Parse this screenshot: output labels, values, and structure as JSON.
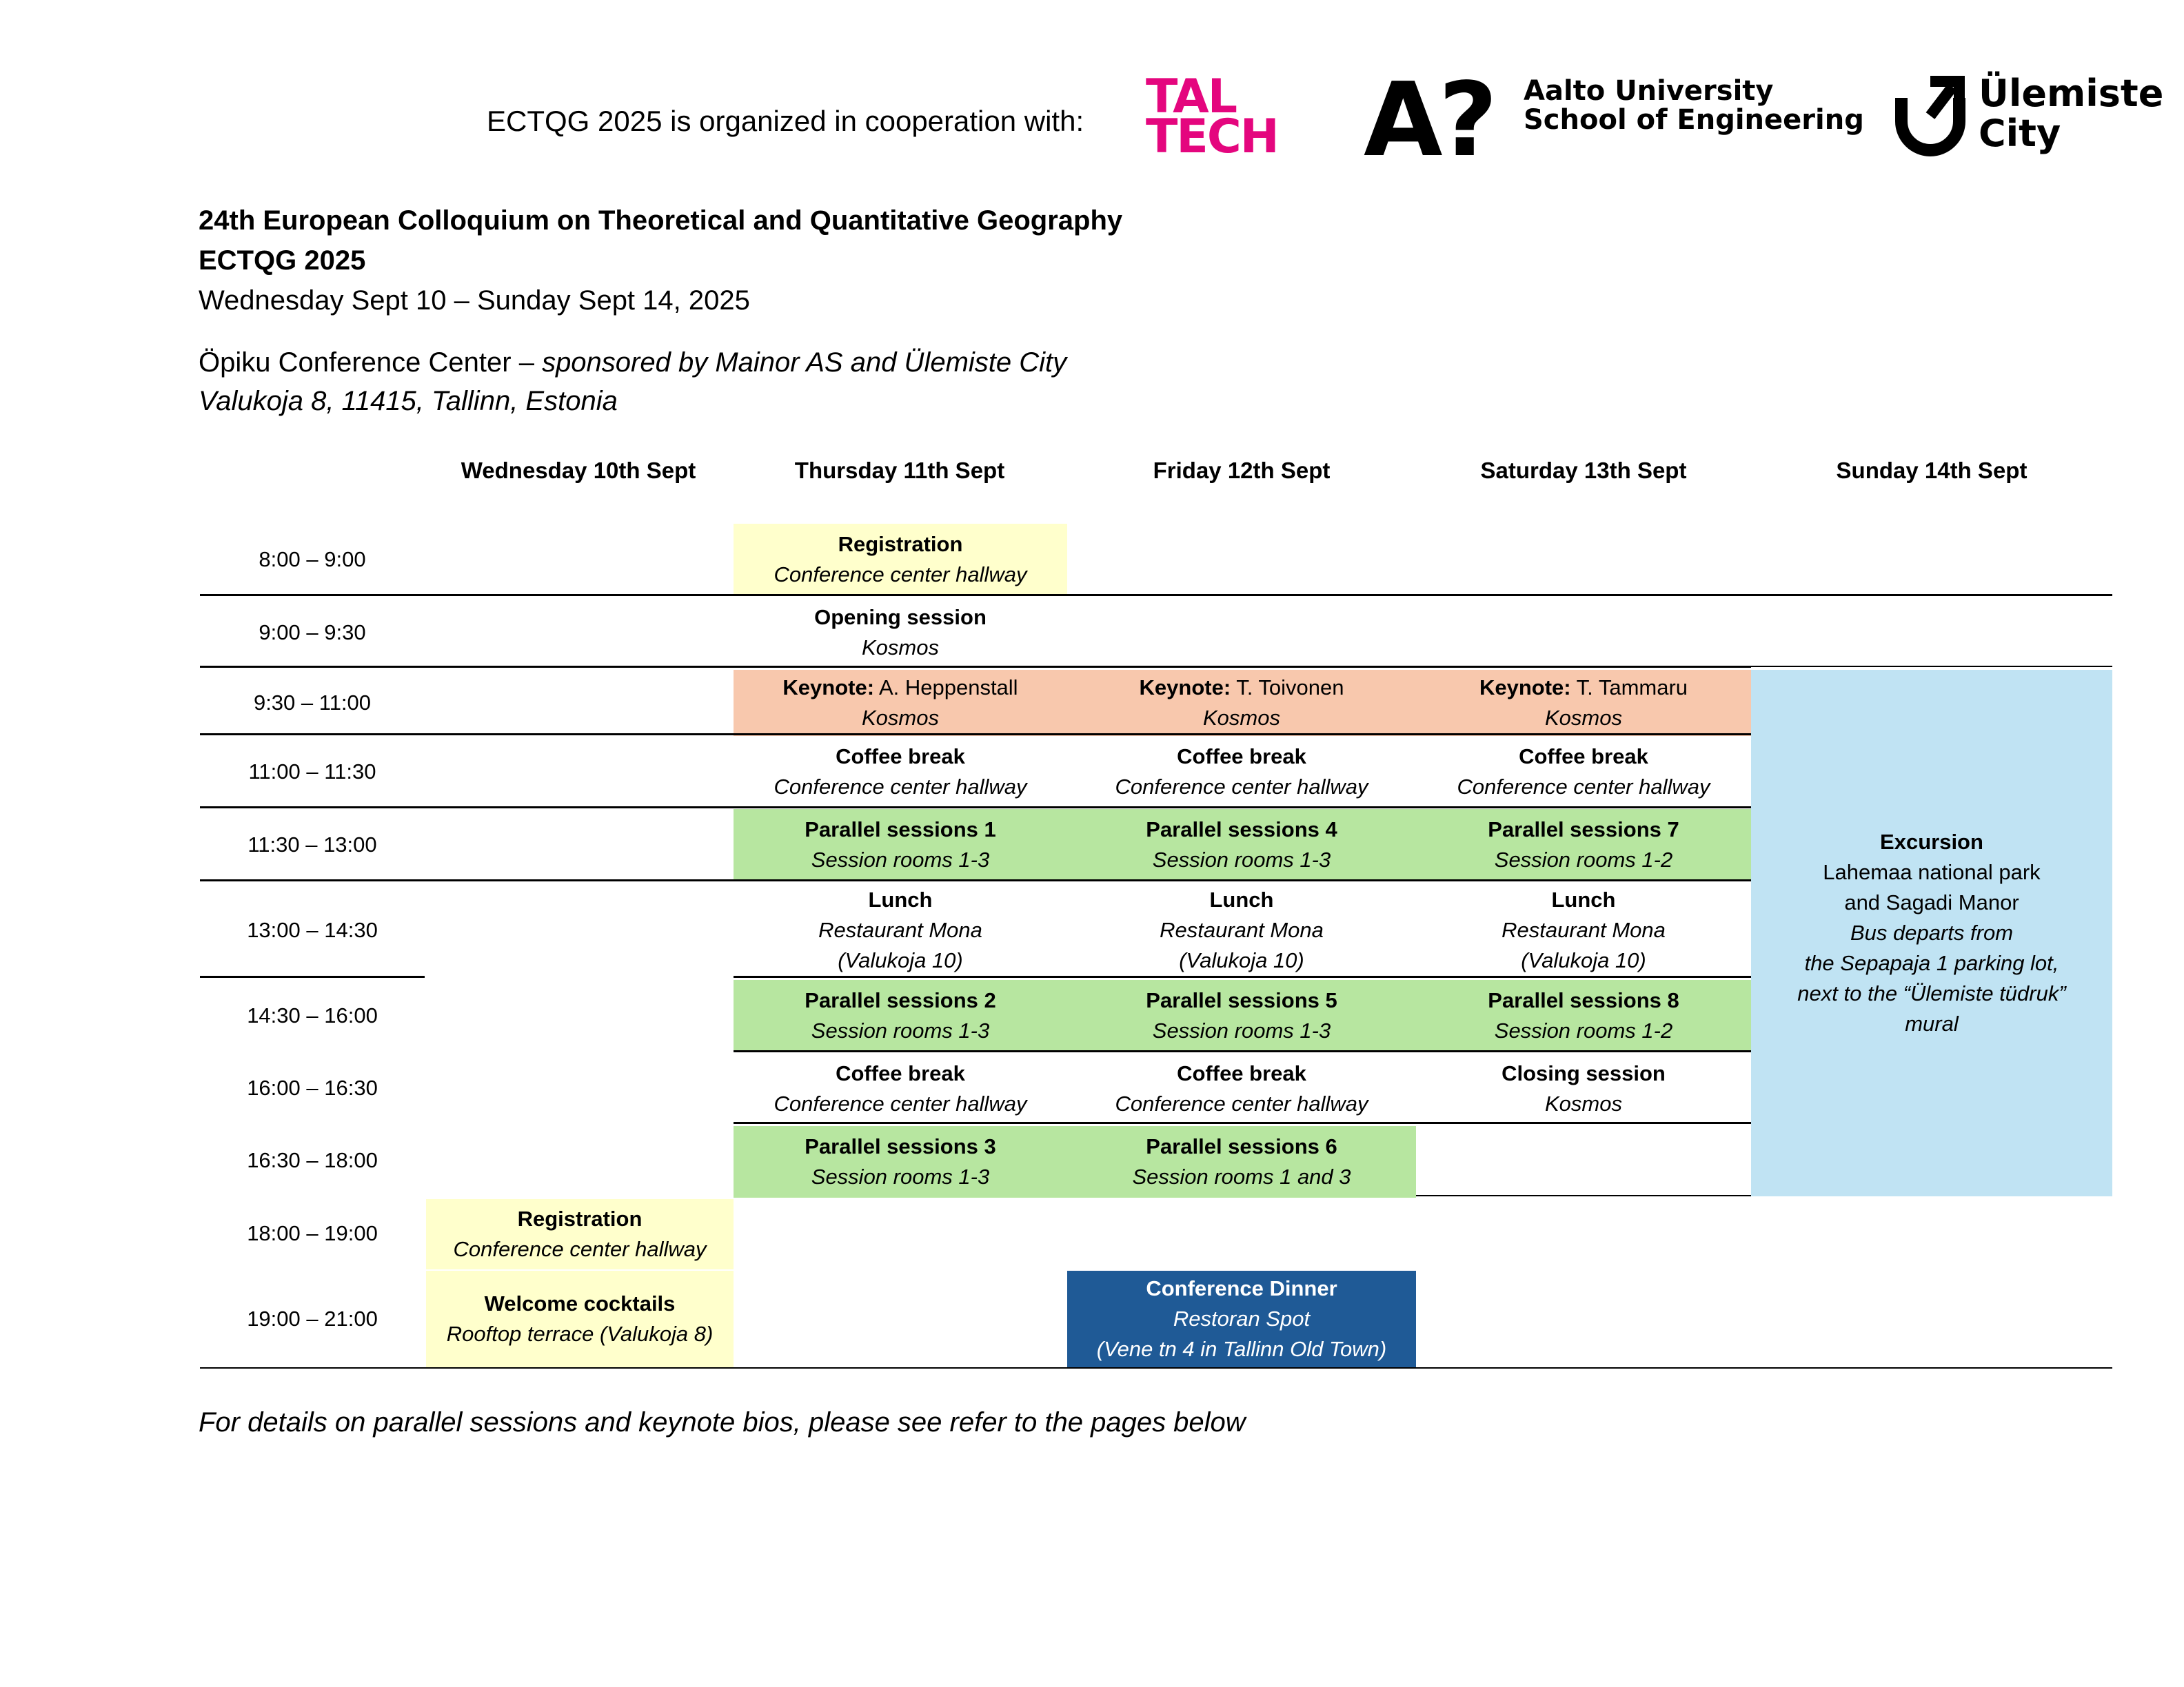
{
  "header": {
    "cooperation_text": "ECTQG 2025 is organized in cooperation with:",
    "logos": {
      "taltech": [
        "TAL",
        "TECH"
      ],
      "aalto_mark": "A?",
      "aalto_lines": [
        "Aalto University",
        "School of Engineering"
      ],
      "ulemiste_lines": [
        "Ülemiste",
        "City"
      ]
    },
    "colors": {
      "taltech": "#e4067e"
    }
  },
  "conference": {
    "title": "24th European Colloquium on Theoretical and Quantitative Geography",
    "short": "ECTQG 2025",
    "dates": "Wednesday Sept 10 – Sunday Sept 14, 2025",
    "venue_name": "Öpiku Conference Center",
    "venue_dash": " – ",
    "venue_sponsor": "sponsored by Mainor AS and Ülemiste City",
    "address": "Valukoja 8, 11415, Tallinn, Estonia"
  },
  "schedule": {
    "days": [
      "Wednesday 10th Sept",
      "Thursday 11th Sept",
      "Friday 12th Sept",
      "Saturday 13th Sept",
      "Sunday 14th Sept"
    ],
    "times": [
      "8:00 – 9:00",
      "9:00 – 9:30",
      "9:30 – 11:00",
      "11:00 – 11:30",
      "11:30 – 13:00",
      "13:00 – 14:30",
      "14:30 – 16:00",
      "16:00 – 16:30",
      "16:30 – 18:00",
      "18:00 – 19:00",
      "19:00 – 21:00"
    ],
    "colors": {
      "registration": "#ffffcc",
      "keynote": "#f8c8ad",
      "parallel": "#b7e6a0",
      "excursion": "#c0e3f3",
      "dinner": "#1f5a96"
    },
    "thu": {
      "registration": {
        "title": "Registration",
        "place": "Conference center hallway"
      },
      "opening": {
        "title": "Opening session",
        "place": "Kosmos"
      },
      "keynote": {
        "label": "Keynote:",
        "name": " A. Heppenstall",
        "place": "Kosmos"
      },
      "coffee1": {
        "title": "Coffee break",
        "place": "Conference center hallway"
      },
      "parallel1": {
        "title": "Parallel sessions 1",
        "place": "Session rooms 1-3"
      },
      "lunch": {
        "title": "Lunch",
        "place": "Restaurant Mona",
        "place2": "(Valukoja 10)"
      },
      "parallel2": {
        "title": "Parallel sessions 2",
        "place": "Session rooms 1-3"
      },
      "coffee2": {
        "title": "Coffee break",
        "place": "Conference center hallway"
      },
      "parallel3": {
        "title": "Parallel sessions 3",
        "place": "Session rooms 1-3"
      }
    },
    "fri": {
      "keynote": {
        "label": "Keynote:",
        "name": " T. Toivonen",
        "place": "Kosmos"
      },
      "coffee1": {
        "title": "Coffee break",
        "place": "Conference center hallway"
      },
      "parallel4": {
        "title": "Parallel sessions 4",
        "place": "Session rooms 1-3"
      },
      "lunch": {
        "title": "Lunch",
        "place": "Restaurant Mona",
        "place2": "(Valukoja 10)"
      },
      "parallel5": {
        "title": "Parallel sessions 5",
        "place": "Session rooms 1-3"
      },
      "coffee2": {
        "title": "Coffee break",
        "place": "Conference center hallway"
      },
      "parallel6": {
        "title": "Parallel sessions 6",
        "place": "Session rooms 1 and 3"
      },
      "dinner": {
        "title": "Conference Dinner",
        "place": "Restoran Spot",
        "place2": "(Vene tn 4 in Tallinn Old Town)"
      }
    },
    "sat": {
      "keynote": {
        "label": "Keynote:",
        "name": " T. Tammaru",
        "place": "Kosmos"
      },
      "coffee1": {
        "title": "Coffee break",
        "place": "Conference center hallway"
      },
      "parallel7": {
        "title": "Parallel sessions 7",
        "place": "Session rooms 1-2"
      },
      "lunch": {
        "title": "Lunch",
        "place": "Restaurant Mona",
        "place2": "(Valukoja 10)"
      },
      "parallel8": {
        "title": "Parallel sessions 8",
        "place": "Session rooms 1-2"
      },
      "closing": {
        "title": "Closing session",
        "place": "Kosmos"
      }
    },
    "wed": {
      "registration": {
        "title": "Registration",
        "place": "Conference center hallway"
      },
      "cocktails": {
        "title": "Welcome cocktails",
        "place": "Rooftop terrace (Valukoja 8)"
      }
    },
    "sun": {
      "excursion": {
        "title": "Excursion",
        "line1": "Lahemaa national park",
        "line2": "and Sagadi Manor",
        "line3": "Bus departs from",
        "line4": "the Sepapaja 1 parking lot,",
        "line5": "next to the “Ülemiste tüdruk”",
        "line6": "mural"
      }
    }
  },
  "footnote": "For details on parallel sessions and keynote bios, please see refer to the pages below"
}
